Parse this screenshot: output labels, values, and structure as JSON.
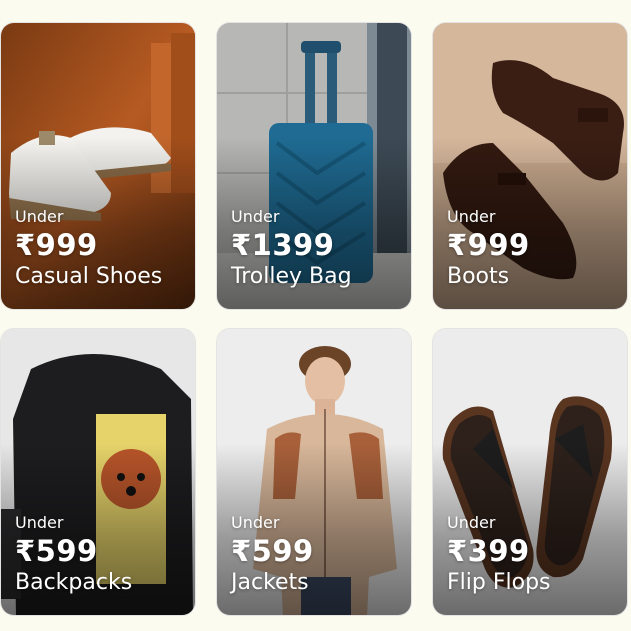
{
  "offers": [
    {
      "under": "Under",
      "price": "₹999",
      "category": "Casual Shoes"
    },
    {
      "under": "Under",
      "price": "₹1399",
      "category": "Trolley Bag"
    },
    {
      "under": "Under",
      "price": "₹999",
      "category": "Boots"
    },
    {
      "under": "Under",
      "price": "₹599",
      "category": "Backpacks"
    },
    {
      "under": "Under",
      "price": "₹599",
      "category": "Jackets"
    },
    {
      "under": "Under",
      "price": "₹399",
      "category": "Flip Flops"
    }
  ]
}
